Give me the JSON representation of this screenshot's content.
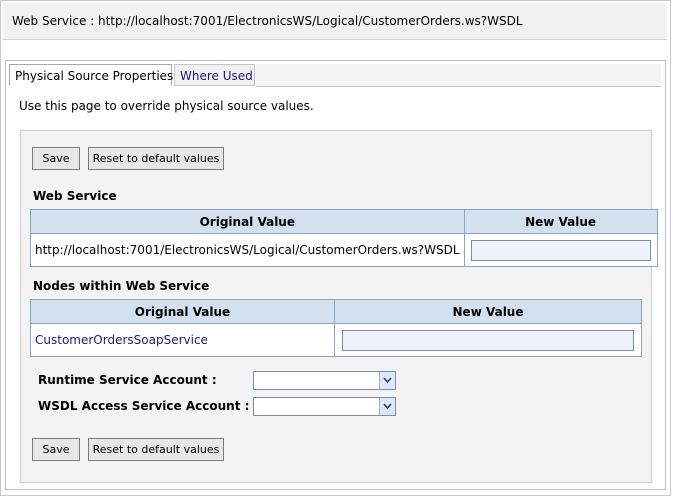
{
  "header": {
    "title": "Web Service : http://localhost:7001/ElectronicsWS/Logical/CustomerOrders.ws?WSDL"
  },
  "tabs": [
    {
      "label": "Physical Source Properties",
      "active": true
    },
    {
      "label": "Where Used",
      "active": false
    }
  ],
  "intro": "Use this page to override physical source values.",
  "toolbar": {
    "save_label": "Save",
    "reset_label": "Reset to default values"
  },
  "web_service": {
    "section_label": "Web Service",
    "headers": {
      "original": "Original Value",
      "new": "New Value"
    },
    "original_value": "http://localhost:7001/ElectronicsWS/Logical/CustomerOrders.ws?WSDL",
    "new_value": ""
  },
  "nodes": {
    "section_label": "Nodes within Web Service",
    "headers": {
      "original": "Original Value",
      "new": "New Value"
    },
    "rows": [
      {
        "original": "CustomerOrdersSoapService",
        "new_value": ""
      }
    ]
  },
  "accounts": {
    "runtime_label": "Runtime Service Account :",
    "runtime_value": "",
    "wsdl_label": "WSDL Access Service Account :",
    "wsdl_value": ""
  },
  "icons": {
    "dropdown": "chevron-down-icon"
  },
  "colors": {
    "header_bg": "#d3e0ef",
    "link": "#1a1a7a",
    "input_bg": "#eef3fb"
  }
}
